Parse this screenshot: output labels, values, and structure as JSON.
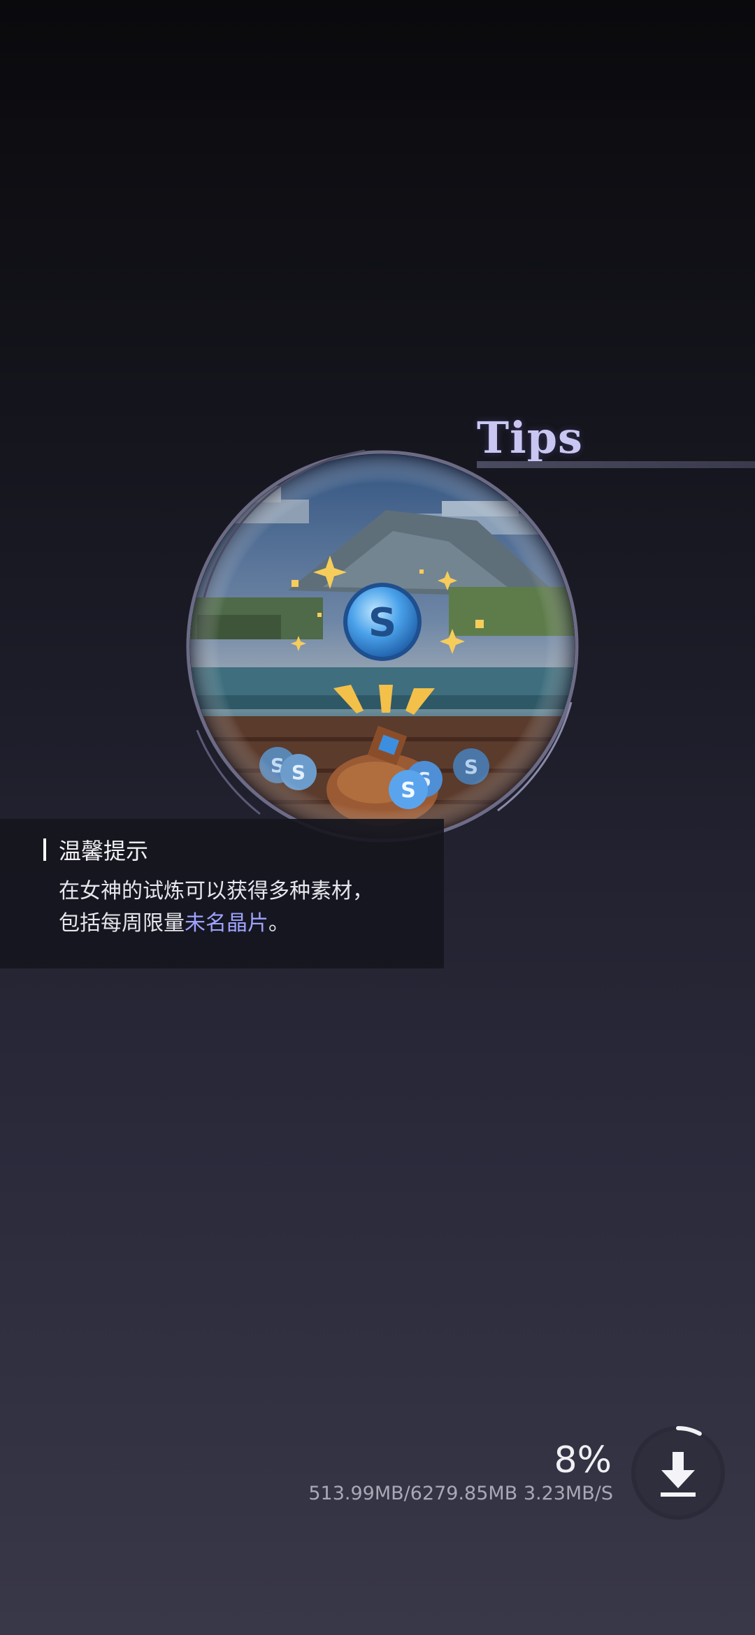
{
  "tips": {
    "title": "Tips"
  },
  "tip_card": {
    "heading": "温馨提示",
    "line1": "在女神的试炼可以获得多种素材，",
    "line2_prefix": "包括每周限量",
    "line2_highlight": "未名晶片",
    "line2_suffix": "。"
  },
  "download": {
    "percent": "8%",
    "progress": 0.08,
    "stats": "513.99MB/6279.85MB 3.23MB/S"
  },
  "illustration": {
    "coin_letter": "S",
    "scene": "pixel-art-coin-pouch"
  },
  "colors": {
    "tips_title": "#c9c7f2",
    "highlight": "#9ea3ff",
    "coin_blue": "#3c8fe0"
  }
}
